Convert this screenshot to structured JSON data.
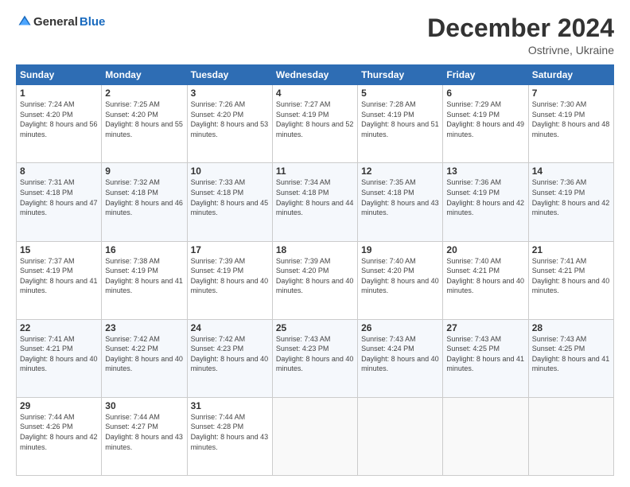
{
  "header": {
    "logo_general": "General",
    "logo_blue": "Blue",
    "title": "December 2024",
    "location": "Ostrivne, Ukraine"
  },
  "days_of_week": [
    "Sunday",
    "Monday",
    "Tuesday",
    "Wednesday",
    "Thursday",
    "Friday",
    "Saturday"
  ],
  "weeks": [
    [
      {
        "day": "1",
        "sunrise": "7:24 AM",
        "sunset": "4:20 PM",
        "daylight": "8 hours and 56 minutes."
      },
      {
        "day": "2",
        "sunrise": "7:25 AM",
        "sunset": "4:20 PM",
        "daylight": "8 hours and 55 minutes."
      },
      {
        "day": "3",
        "sunrise": "7:26 AM",
        "sunset": "4:20 PM",
        "daylight": "8 hours and 53 minutes."
      },
      {
        "day": "4",
        "sunrise": "7:27 AM",
        "sunset": "4:19 PM",
        "daylight": "8 hours and 52 minutes."
      },
      {
        "day": "5",
        "sunrise": "7:28 AM",
        "sunset": "4:19 PM",
        "daylight": "8 hours and 51 minutes."
      },
      {
        "day": "6",
        "sunrise": "7:29 AM",
        "sunset": "4:19 PM",
        "daylight": "8 hours and 49 minutes."
      },
      {
        "day": "7",
        "sunrise": "7:30 AM",
        "sunset": "4:19 PM",
        "daylight": "8 hours and 48 minutes."
      }
    ],
    [
      {
        "day": "8",
        "sunrise": "7:31 AM",
        "sunset": "4:18 PM",
        "daylight": "8 hours and 47 minutes."
      },
      {
        "day": "9",
        "sunrise": "7:32 AM",
        "sunset": "4:18 PM",
        "daylight": "8 hours and 46 minutes."
      },
      {
        "day": "10",
        "sunrise": "7:33 AM",
        "sunset": "4:18 PM",
        "daylight": "8 hours and 45 minutes."
      },
      {
        "day": "11",
        "sunrise": "7:34 AM",
        "sunset": "4:18 PM",
        "daylight": "8 hours and 44 minutes."
      },
      {
        "day": "12",
        "sunrise": "7:35 AM",
        "sunset": "4:18 PM",
        "daylight": "8 hours and 43 minutes."
      },
      {
        "day": "13",
        "sunrise": "7:36 AM",
        "sunset": "4:19 PM",
        "daylight": "8 hours and 42 minutes."
      },
      {
        "day": "14",
        "sunrise": "7:36 AM",
        "sunset": "4:19 PM",
        "daylight": "8 hours and 42 minutes."
      }
    ],
    [
      {
        "day": "15",
        "sunrise": "7:37 AM",
        "sunset": "4:19 PM",
        "daylight": "8 hours and 41 minutes."
      },
      {
        "day": "16",
        "sunrise": "7:38 AM",
        "sunset": "4:19 PM",
        "daylight": "8 hours and 41 minutes."
      },
      {
        "day": "17",
        "sunrise": "7:39 AM",
        "sunset": "4:19 PM",
        "daylight": "8 hours and 40 minutes."
      },
      {
        "day": "18",
        "sunrise": "7:39 AM",
        "sunset": "4:20 PM",
        "daylight": "8 hours and 40 minutes."
      },
      {
        "day": "19",
        "sunrise": "7:40 AM",
        "sunset": "4:20 PM",
        "daylight": "8 hours and 40 minutes."
      },
      {
        "day": "20",
        "sunrise": "7:40 AM",
        "sunset": "4:21 PM",
        "daylight": "8 hours and 40 minutes."
      },
      {
        "day": "21",
        "sunrise": "7:41 AM",
        "sunset": "4:21 PM",
        "daylight": "8 hours and 40 minutes."
      }
    ],
    [
      {
        "day": "22",
        "sunrise": "7:41 AM",
        "sunset": "4:21 PM",
        "daylight": "8 hours and 40 minutes."
      },
      {
        "day": "23",
        "sunrise": "7:42 AM",
        "sunset": "4:22 PM",
        "daylight": "8 hours and 40 minutes."
      },
      {
        "day": "24",
        "sunrise": "7:42 AM",
        "sunset": "4:23 PM",
        "daylight": "8 hours and 40 minutes."
      },
      {
        "day": "25",
        "sunrise": "7:43 AM",
        "sunset": "4:23 PM",
        "daylight": "8 hours and 40 minutes."
      },
      {
        "day": "26",
        "sunrise": "7:43 AM",
        "sunset": "4:24 PM",
        "daylight": "8 hours and 40 minutes."
      },
      {
        "day": "27",
        "sunrise": "7:43 AM",
        "sunset": "4:25 PM",
        "daylight": "8 hours and 41 minutes."
      },
      {
        "day": "28",
        "sunrise": "7:43 AM",
        "sunset": "4:25 PM",
        "daylight": "8 hours and 41 minutes."
      }
    ],
    [
      {
        "day": "29",
        "sunrise": "7:44 AM",
        "sunset": "4:26 PM",
        "daylight": "8 hours and 42 minutes."
      },
      {
        "day": "30",
        "sunrise": "7:44 AM",
        "sunset": "4:27 PM",
        "daylight": "8 hours and 43 minutes."
      },
      {
        "day": "31",
        "sunrise": "7:44 AM",
        "sunset": "4:28 PM",
        "daylight": "8 hours and 43 minutes."
      },
      null,
      null,
      null,
      null
    ]
  ]
}
